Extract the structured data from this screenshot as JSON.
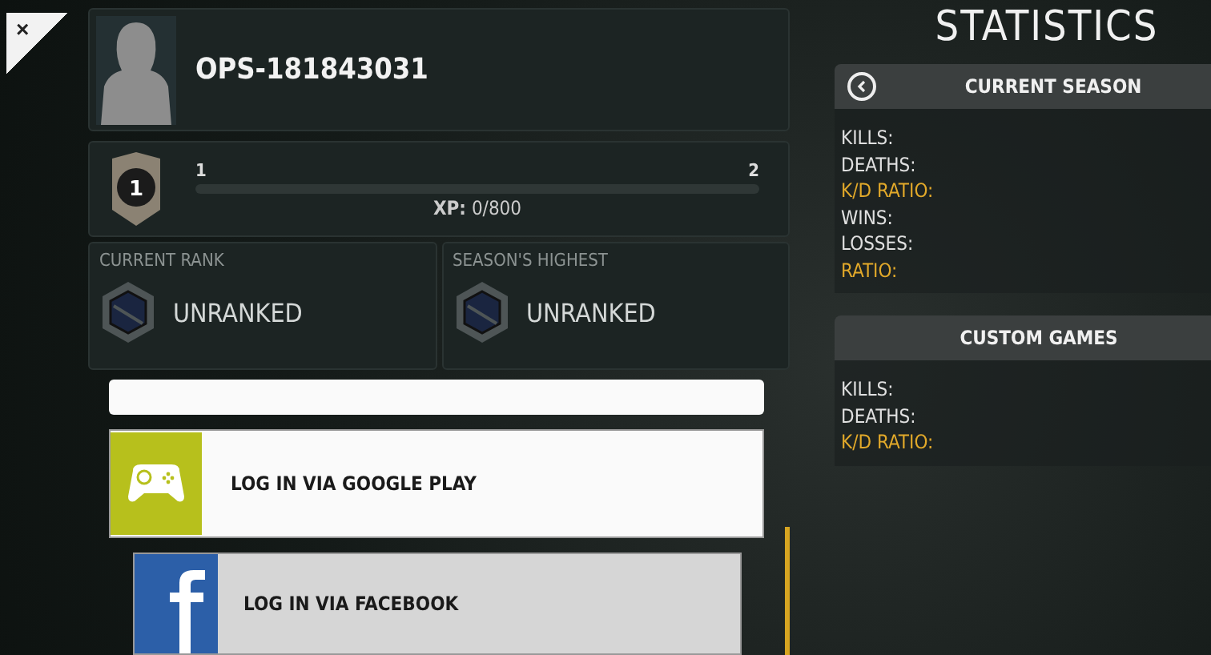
{
  "close_button": {
    "label": "×"
  },
  "profile": {
    "name": "OPS-181843031"
  },
  "level": {
    "badge": "1",
    "start": "1",
    "end": "2",
    "level": 0,
    "xp_label": "XP:",
    "xp_value": "0/800"
  },
  "ranks": [
    {
      "title": "CURRENT RANK",
      "rank": "UNRANKED"
    },
    {
      "title": "SEASON'S HIGHEST",
      "rank": "UNRANKED"
    }
  ],
  "login_buttons": [
    {
      "kind": "google",
      "label": "LOG IN VIA GOOGLE PLAY"
    },
    {
      "kind": "facebook",
      "label": "LOG IN VIA FACEBOOK"
    }
  ],
  "statistics": {
    "title": "STATISTICS",
    "sections": [
      {
        "title": "CURRENT SEASON",
        "back_button": true,
        "rows": [
          {
            "label": "KILLS:",
            "highlighted": false
          },
          {
            "label": "DEATHS:",
            "highlighted": false
          },
          {
            "label": "K/D RATIO:",
            "highlighted": true
          },
          {
            "label": "WINS:",
            "highlighted": false
          },
          {
            "label": "LOSSES:",
            "highlighted": false
          },
          {
            "label": "RATIO:",
            "highlighted": true
          }
        ]
      },
      {
        "title": "CUSTOM GAMES",
        "back_button": false,
        "rows": [
          {
            "label": "KILLS:",
            "highlighted": false
          },
          {
            "label": "DEATHS:",
            "highlighted": false
          },
          {
            "label": "K/D RATIO:",
            "highlighted": true
          }
        ]
      }
    ]
  }
}
